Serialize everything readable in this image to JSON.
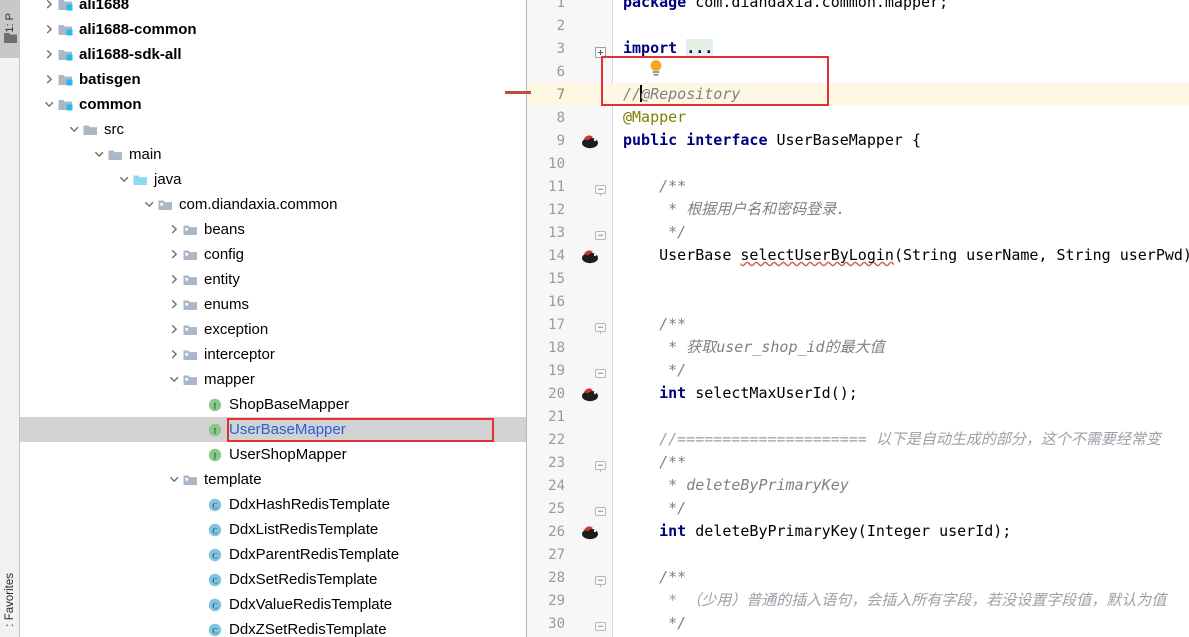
{
  "toolwindow_stripe": {
    "project_tab": "1: P",
    "project_icon": "folder-icon",
    "favorites_tab": ": Favorites"
  },
  "project_tree": {
    "rows": [
      {
        "label": "ali1688",
        "indent": 0,
        "arrow": "chevron-right",
        "icon": "module-icon",
        "bold": true,
        "selected": false,
        "clipped": true
      },
      {
        "label": "ali1688-common",
        "indent": 0,
        "arrow": "chevron-right",
        "icon": "module-icon",
        "bold": true,
        "selected": false
      },
      {
        "label": "ali1688-sdk-all",
        "indent": 0,
        "arrow": "chevron-right",
        "icon": "module-icon",
        "bold": true,
        "selected": false
      },
      {
        "label": "batisgen",
        "indent": 0,
        "arrow": "chevron-right",
        "icon": "module-icon",
        "bold": true,
        "selected": false
      },
      {
        "label": "common",
        "indent": 0,
        "arrow": "chevron-down",
        "icon": "module-icon",
        "bold": true,
        "selected": false
      },
      {
        "label": "src",
        "indent": 1,
        "arrow": "chevron-down",
        "icon": "folder-icon",
        "bold": false,
        "selected": false
      },
      {
        "label": "main",
        "indent": 2,
        "arrow": "chevron-down",
        "icon": "folder-icon",
        "bold": false,
        "selected": false
      },
      {
        "label": "java",
        "indent": 3,
        "arrow": "chevron-down",
        "icon": "source-root-icon",
        "bold": false,
        "selected": false
      },
      {
        "label": "com.diandaxia.common",
        "indent": 4,
        "arrow": "chevron-down",
        "icon": "package-icon",
        "bold": false,
        "selected": false
      },
      {
        "label": "beans",
        "indent": 5,
        "arrow": "chevron-right",
        "icon": "package-icon",
        "bold": false,
        "selected": false
      },
      {
        "label": "config",
        "indent": 5,
        "arrow": "chevron-right",
        "icon": "package-icon",
        "bold": false,
        "selected": false
      },
      {
        "label": "entity",
        "indent": 5,
        "arrow": "chevron-right",
        "icon": "package-icon",
        "bold": false,
        "selected": false
      },
      {
        "label": "enums",
        "indent": 5,
        "arrow": "chevron-right",
        "icon": "package-icon",
        "bold": false,
        "selected": false
      },
      {
        "label": "exception",
        "indent": 5,
        "arrow": "chevron-right",
        "icon": "package-icon",
        "bold": false,
        "selected": false
      },
      {
        "label": "interceptor",
        "indent": 5,
        "arrow": "chevron-right",
        "icon": "package-icon",
        "bold": false,
        "selected": false
      },
      {
        "label": "mapper",
        "indent": 5,
        "arrow": "chevron-down",
        "icon": "package-icon",
        "bold": false,
        "selected": false
      },
      {
        "label": "ShopBaseMapper",
        "indent": 6,
        "arrow": "none",
        "icon": "interface-icon",
        "bold": false,
        "selected": false
      },
      {
        "label": "UserBaseMapper",
        "indent": 6,
        "arrow": "none",
        "icon": "interface-icon",
        "bold": false,
        "selected": true
      },
      {
        "label": "UserShopMapper",
        "indent": 6,
        "arrow": "none",
        "icon": "interface-icon",
        "bold": false,
        "selected": false
      },
      {
        "label": "template",
        "indent": 5,
        "arrow": "chevron-down",
        "icon": "package-icon",
        "bold": false,
        "selected": false
      },
      {
        "label": "DdxHashRedisTemplate",
        "indent": 6,
        "arrow": "none",
        "icon": "class-icon",
        "bold": false,
        "selected": false
      },
      {
        "label": "DdxListRedisTemplate",
        "indent": 6,
        "arrow": "none",
        "icon": "class-icon",
        "bold": false,
        "selected": false
      },
      {
        "label": "DdxParentRedisTemplate",
        "indent": 6,
        "arrow": "none",
        "icon": "class-icon",
        "bold": false,
        "selected": false
      },
      {
        "label": "DdxSetRedisTemplate",
        "indent": 6,
        "arrow": "none",
        "icon": "class-icon",
        "bold": false,
        "selected": false
      },
      {
        "label": "DdxValueRedisTemplate",
        "indent": 6,
        "arrow": "none",
        "icon": "class-icon",
        "bold": false,
        "selected": false
      },
      {
        "label": "DdxZSetRedisTemplate",
        "indent": 6,
        "arrow": "none",
        "icon": "class-icon",
        "bold": false,
        "selected": false
      }
    ]
  },
  "editor": {
    "caret_line_number": 7,
    "lines": [
      {
        "no": "1",
        "gutter": "none",
        "fold": "none",
        "clipped": true,
        "tokens": [
          {
            "t": "package ",
            "c": "kw"
          },
          {
            "t": "com.diandaxia.common.mapper;",
            "c": "pln"
          }
        ]
      },
      {
        "no": "2",
        "gutter": "none",
        "fold": "none",
        "tokens": []
      },
      {
        "no": "3",
        "gutter": "none",
        "fold": "plus",
        "tokens": [
          {
            "t": "import ",
            "c": "kw"
          },
          {
            "t": "...",
            "c": "fold"
          }
        ]
      },
      {
        "no": "6",
        "gutter": "none",
        "fold": "none",
        "tokens": []
      },
      {
        "no": "7",
        "gutter": "none",
        "fold": "none",
        "caret": true,
        "tokens": [
          {
            "t": "//",
            "c": "cmt"
          },
          {
            "t": "caret",
            "c": "caret"
          },
          {
            "t": "@Repository",
            "c": "cmt"
          }
        ]
      },
      {
        "no": "8",
        "gutter": "none",
        "fold": "none",
        "tokens": [
          {
            "t": "@Mapper",
            "c": "anno"
          }
        ]
      },
      {
        "no": "9",
        "gutter": "bean",
        "fold": "none",
        "tokens": [
          {
            "t": "public interface ",
            "c": "kw"
          },
          {
            "t": "UserBaseMapper {",
            "c": "pln"
          }
        ]
      },
      {
        "no": "10",
        "gutter": "none",
        "fold": "none",
        "tokens": []
      },
      {
        "no": "11",
        "gutter": "none",
        "fold": "collapse-top",
        "tokens": [
          {
            "t": "    /**",
            "c": "cmt"
          }
        ]
      },
      {
        "no": "12",
        "gutter": "none",
        "fold": "none",
        "tokens": [
          {
            "t": "     * 根据用户名和密码登录.",
            "c": "cmt"
          }
        ]
      },
      {
        "no": "13",
        "gutter": "none",
        "fold": "collapse-bot",
        "tokens": [
          {
            "t": "     */",
            "c": "cmt"
          }
        ]
      },
      {
        "no": "14",
        "gutter": "bean",
        "fold": "none",
        "tokens": [
          {
            "t": "    UserBase ",
            "c": "pln"
          },
          {
            "t": "selectUserByLogin",
            "c": "squiggle"
          },
          {
            "t": "(String userName, String userPwd)",
            "c": "pln"
          }
        ]
      },
      {
        "no": "15",
        "gutter": "none",
        "fold": "none",
        "tokens": []
      },
      {
        "no": "16",
        "gutter": "none",
        "fold": "none",
        "tokens": []
      },
      {
        "no": "17",
        "gutter": "none",
        "fold": "collapse-top",
        "tokens": [
          {
            "t": "    /**",
            "c": "cmt"
          }
        ]
      },
      {
        "no": "18",
        "gutter": "none",
        "fold": "none",
        "tokens": [
          {
            "t": "     * 获取user_shop_id的最大值",
            "c": "cmt"
          }
        ]
      },
      {
        "no": "19",
        "gutter": "none",
        "fold": "collapse-bot",
        "tokens": [
          {
            "t": "     */",
            "c": "cmt"
          }
        ]
      },
      {
        "no": "20",
        "gutter": "bean",
        "fold": "none",
        "tokens": [
          {
            "t": "    int ",
            "c": "kw"
          },
          {
            "t": "selectMaxUserId();",
            "c": "pln"
          }
        ]
      },
      {
        "no": "21",
        "gutter": "none",
        "fold": "none",
        "tokens": []
      },
      {
        "no": "22",
        "gutter": "none",
        "fold": "none",
        "tokens": [
          {
            "t": "    //===================== 以下是自动生成的部分，这个不需要经常变",
            "c": "cmt2"
          }
        ]
      },
      {
        "no": "23",
        "gutter": "none",
        "fold": "collapse-top",
        "tokens": [
          {
            "t": "    /**",
            "c": "cmt"
          }
        ]
      },
      {
        "no": "24",
        "gutter": "none",
        "fold": "none",
        "tokens": [
          {
            "t": "     * deleteByPrimaryKey",
            "c": "cmt"
          }
        ]
      },
      {
        "no": "25",
        "gutter": "none",
        "fold": "collapse-bot",
        "tokens": [
          {
            "t": "     */",
            "c": "cmt"
          }
        ]
      },
      {
        "no": "26",
        "gutter": "bean",
        "fold": "none",
        "tokens": [
          {
            "t": "    int ",
            "c": "kw"
          },
          {
            "t": "deleteByPrimaryKey(Integer userId);",
            "c": "pln"
          }
        ]
      },
      {
        "no": "27",
        "gutter": "none",
        "fold": "none",
        "tokens": []
      },
      {
        "no": "28",
        "gutter": "none",
        "fold": "collapse-top",
        "tokens": [
          {
            "t": "    /**",
            "c": "cmt"
          }
        ]
      },
      {
        "no": "29",
        "gutter": "none",
        "fold": "none",
        "tokens": [
          {
            "t": "     * （少用）普通的插入语句，会插入所有字段，若没设置字段值，默认为值",
            "c": "cmt2"
          }
        ]
      },
      {
        "no": "30",
        "gutter": "none",
        "fold": "collapse-bot",
        "tokens": [
          {
            "t": "     */",
            "c": "cmt"
          }
        ]
      }
    ]
  },
  "annotations": {
    "tree_box_label": "red-highlight-box-usermapper",
    "code_box_label": "red-highlight-box-repository-line",
    "pointer_label": "red-pointer-line",
    "bulb_label": "intention-bulb-icon",
    "accent_red": "#e03232",
    "selection_gray": "#d2d2d2",
    "caret_line_yellow": "#fdf7e4"
  }
}
